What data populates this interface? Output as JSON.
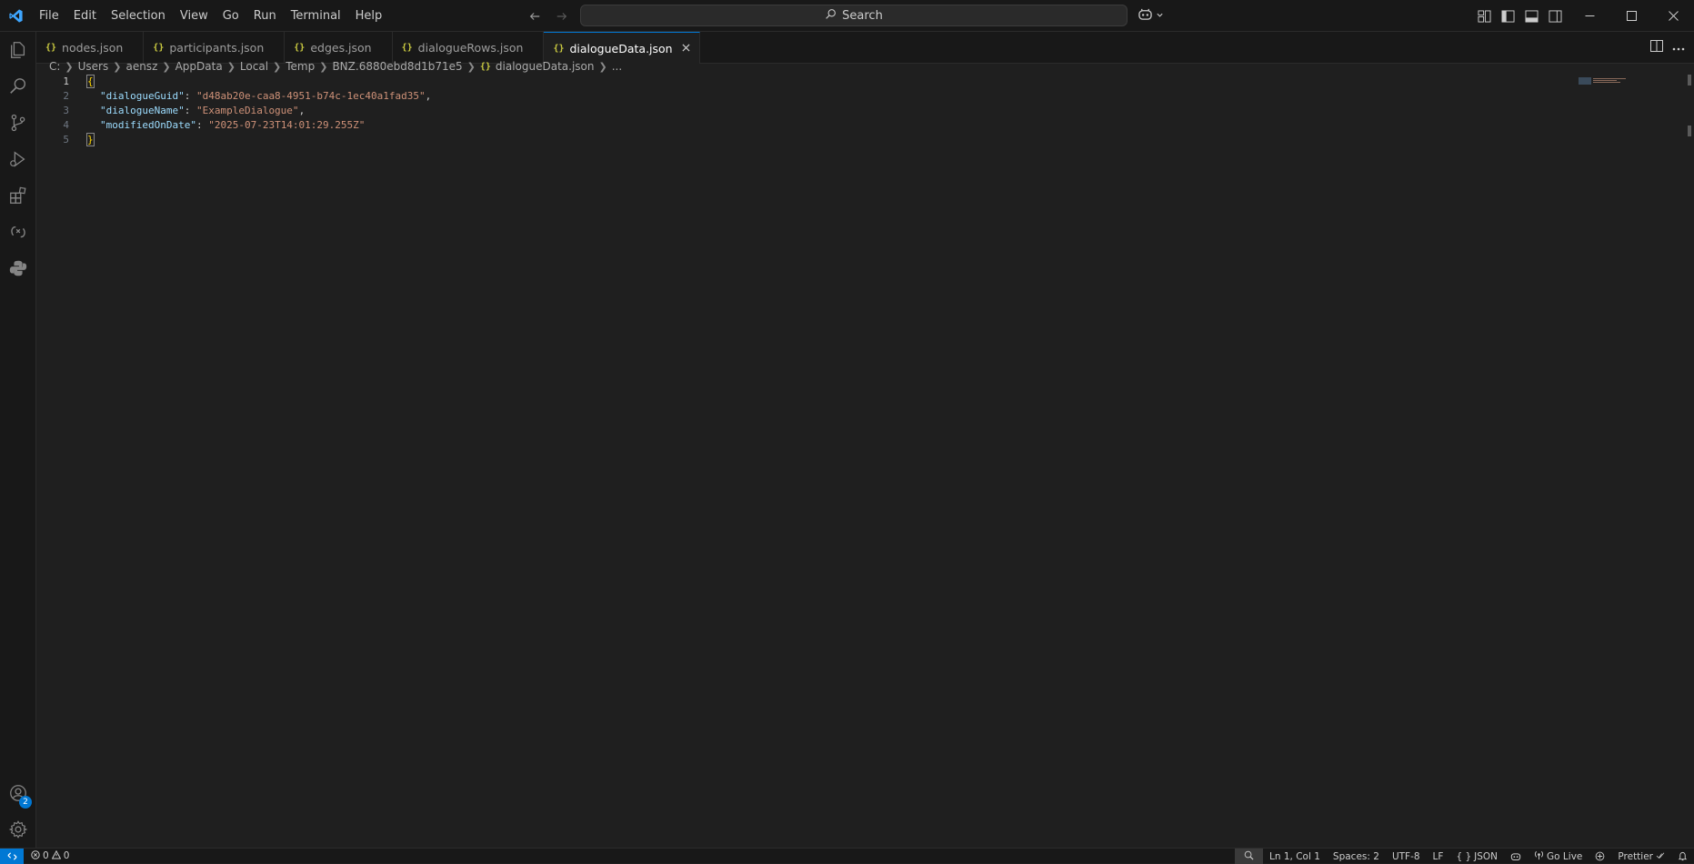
{
  "titlebar": {
    "menu": [
      "File",
      "Edit",
      "Selection",
      "View",
      "Go",
      "Run",
      "Terminal",
      "Help"
    ],
    "search_label": "Search"
  },
  "tabs": [
    {
      "label": "nodes.json",
      "icon": "{}",
      "active": false
    },
    {
      "label": "participants.json",
      "icon": "{}",
      "active": false
    },
    {
      "label": "edges.json",
      "icon": "{}",
      "active": false
    },
    {
      "label": "dialogueRows.json",
      "icon": "{}",
      "active": false
    },
    {
      "label": "dialogueData.json",
      "icon": "{}",
      "active": true
    }
  ],
  "breadcrumb": {
    "segments": [
      "C:",
      "Users",
      "aensz",
      "AppData",
      "Local",
      "Temp",
      "BNZ.6880ebd8d1b71e5"
    ],
    "file_icon": "{}",
    "file": "dialogueData.json",
    "more": "..."
  },
  "editor": {
    "line_numbers": [
      "1",
      "2",
      "3",
      "4",
      "5"
    ],
    "open_brace": "{",
    "close_brace": "}",
    "entries": [
      {
        "key": "\"dialogueGuid\"",
        "value": "\"d48ab20e-caa8-4951-b74c-1ec40a1fad35\"",
        "comma": ","
      },
      {
        "key": "\"dialogueName\"",
        "value": "\"ExampleDialogue\"",
        "comma": ","
      },
      {
        "key": "\"modifiedOnDate\"",
        "value": "\"2025-07-23T14:01:29.255Z\"",
        "comma": ""
      }
    ]
  },
  "activity": {
    "accounts_badge": "2"
  },
  "statusbar": {
    "errors": "0",
    "warnings": "0",
    "cursor": "Ln 1, Col 1",
    "spaces": "Spaces: 2",
    "encoding": "UTF-8",
    "eol": "LF",
    "language": "JSON",
    "golive": "Go Live",
    "prettier": "Prettier"
  },
  "colors": {
    "accent": "#0078d4",
    "json_key": "#9cdcfe",
    "json_string": "#ce9178",
    "brace": "#ffd700"
  }
}
